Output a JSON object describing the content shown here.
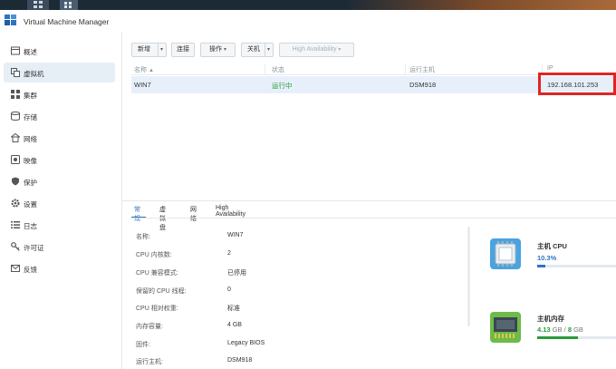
{
  "app": {
    "title": "Virtual Machine Manager"
  },
  "sidebar": {
    "items": [
      {
        "label": "概述",
        "icon": "overview-icon"
      },
      {
        "label": "虚拟机",
        "icon": "virtual-machine-icon",
        "active": true
      },
      {
        "label": "集群",
        "icon": "cluster-icon"
      },
      {
        "label": "存储",
        "icon": "storage-icon"
      },
      {
        "label": "网络",
        "icon": "network-icon"
      },
      {
        "label": "映像",
        "icon": "image-icon"
      },
      {
        "label": "保护",
        "icon": "protection-icon"
      },
      {
        "label": "设置",
        "icon": "settings-icon"
      },
      {
        "label": "日志",
        "icon": "log-icon"
      },
      {
        "label": "许可证",
        "icon": "license-icon"
      },
      {
        "label": "反馈",
        "icon": "feedback-icon"
      }
    ]
  },
  "toolbar": {
    "new_label": "新增",
    "connect_label": "连接",
    "action_label": "操作",
    "shutdown_label": "关机",
    "ha_label": "High Availability"
  },
  "grid": {
    "headers": {
      "name": "名称",
      "status": "状态",
      "host": "运行主机",
      "ip": "IP"
    },
    "rows": [
      {
        "name": "WIN7",
        "status": "运行中",
        "host": "DSM918",
        "ip": "192.168.101.253"
      }
    ]
  },
  "detail": {
    "tabs": [
      "常规",
      "虚拟盘",
      "网络",
      "High Availability"
    ],
    "properties": [
      {
        "label": "名称:",
        "value": "WIN7"
      },
      {
        "label": "CPU 内核数:",
        "value": "2"
      },
      {
        "label": "CPU 兼容模式:",
        "value": "已停用"
      },
      {
        "label": "保留的 CPU 线程:",
        "value": "0"
      },
      {
        "label": "CPU 相对权重:",
        "value": "标准"
      },
      {
        "label": "内存容量:",
        "value": "4 GB"
      },
      {
        "label": "固件:",
        "value": "Legacy BIOS"
      },
      {
        "label": "运行主机:",
        "value": "DSM918"
      }
    ]
  },
  "resources": {
    "cpu": {
      "title": "主机 CPU",
      "value": "10.3",
      "unit": "%",
      "fraction": 0.103
    },
    "memory": {
      "title": "主机内存",
      "used": "4.13",
      "used_unit": "GB",
      "sep": "/",
      "total": "8",
      "total_unit": "GB",
      "fraction": 0.516
    }
  },
  "colors": {
    "accent": "#2d74c2",
    "running": "#2b9a3b",
    "highlight": "#e02424",
    "selected_row": "#e7f0fa"
  }
}
